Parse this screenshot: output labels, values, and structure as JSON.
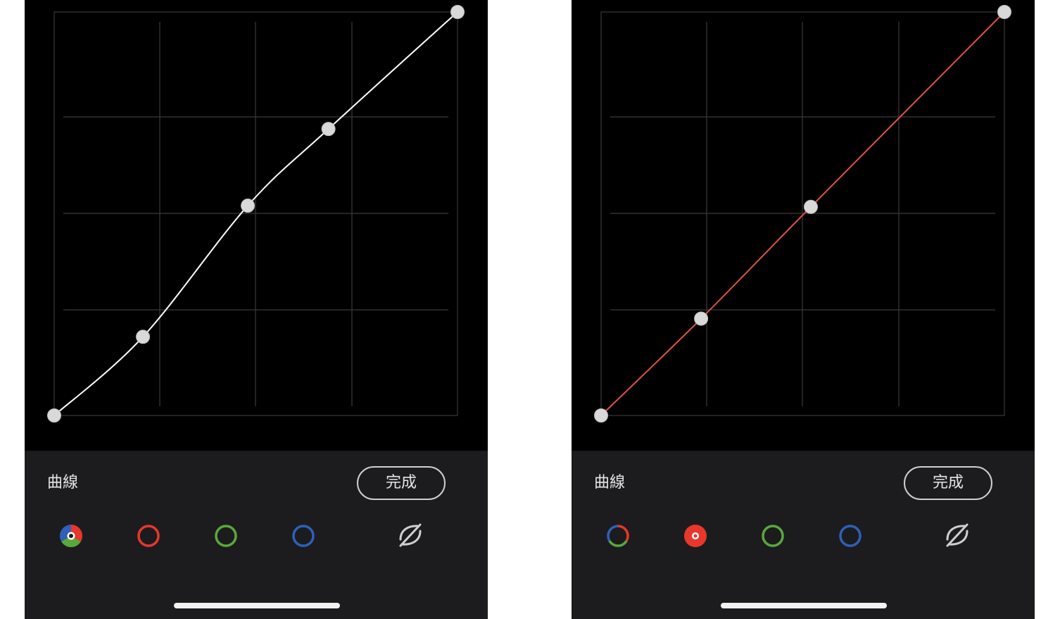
{
  "screens": [
    {
      "panel_title": "曲線",
      "done_label": "完成",
      "active_channel": "rgb",
      "curve_color": "#ffffff",
      "curve_points": [
        [
          0,
          0
        ],
        [
          0.22,
          0.195
        ],
        [
          0.48,
          0.52
        ],
        [
          0.68,
          0.71
        ],
        [
          1,
          1
        ]
      ],
      "channels": [
        {
          "id": "rgb",
          "icon": "rgb-channel-icon",
          "selected": true
        },
        {
          "id": "red",
          "icon": "red-channel-icon",
          "selected": false
        },
        {
          "id": "green",
          "icon": "green-channel-icon",
          "selected": false
        },
        {
          "id": "blue",
          "icon": "blue-channel-icon",
          "selected": false
        }
      ],
      "reset_icon": "curve-reset-icon"
    },
    {
      "panel_title": "曲線",
      "done_label": "完成",
      "active_channel": "red",
      "curve_color": "#e0533f",
      "curve_points": [
        [
          0,
          0
        ],
        [
          0.248,
          0.24
        ],
        [
          0.52,
          0.517
        ],
        [
          1,
          1
        ]
      ],
      "channels": [
        {
          "id": "rgb",
          "icon": "rgb-channel-icon",
          "selected": false
        },
        {
          "id": "red",
          "icon": "red-channel-icon",
          "selected": true
        },
        {
          "id": "green",
          "icon": "green-channel-icon",
          "selected": false
        },
        {
          "id": "blue",
          "icon": "blue-channel-icon",
          "selected": false
        }
      ],
      "reset_icon": "curve-reset-icon"
    }
  ],
  "colors": {
    "red": "#e8372c",
    "green": "#5aa83c",
    "blue": "#2f5fb8",
    "grid": "#3a3a3a",
    "handle": "#d9d9d9"
  }
}
